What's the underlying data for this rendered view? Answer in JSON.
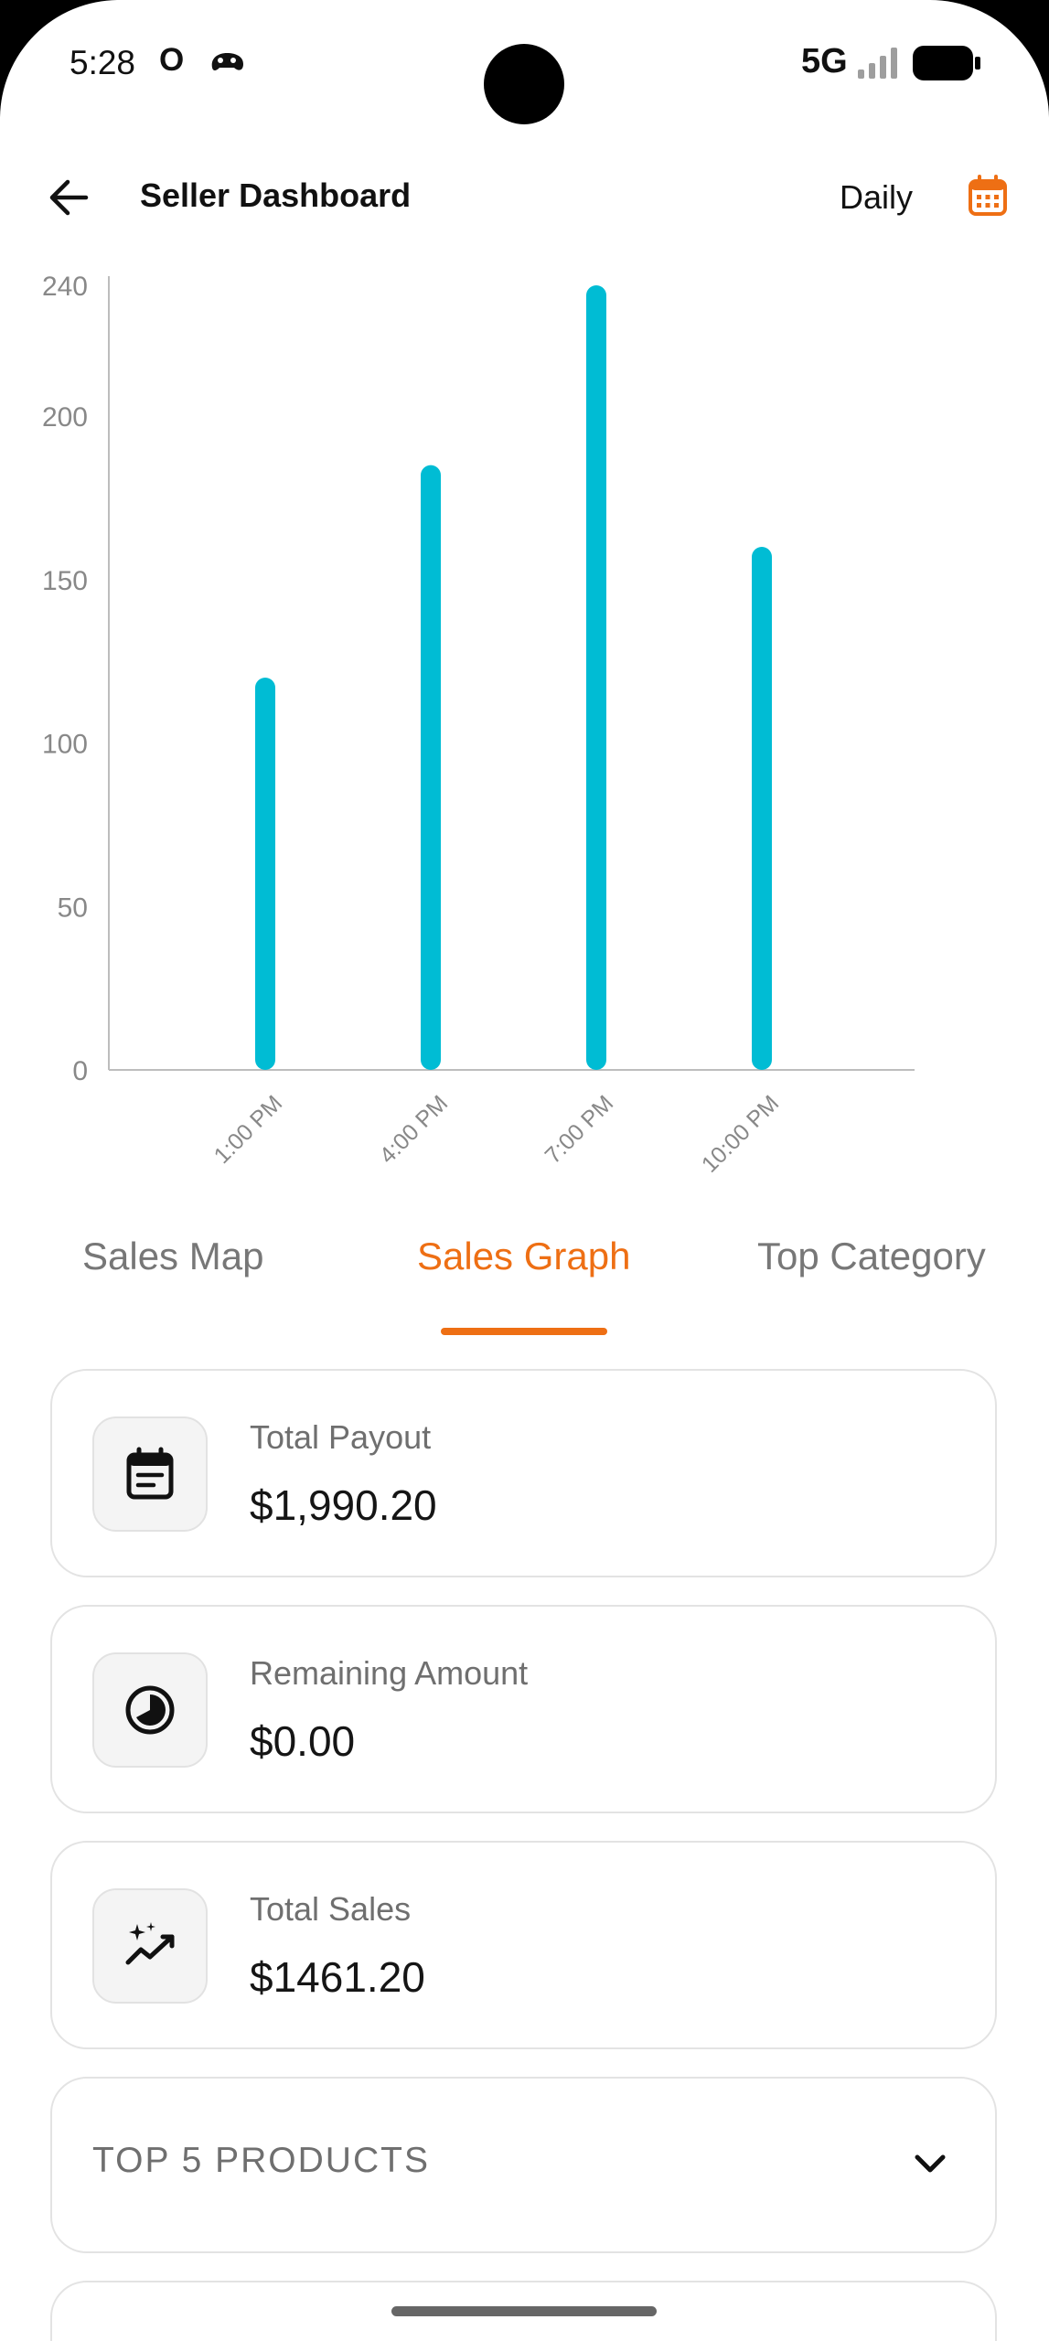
{
  "status_bar": {
    "time": "5:28",
    "notification_letter": "O",
    "app_icon": "game-controller-icon",
    "network": "5G",
    "signal_icon": "cell-signal-icon",
    "battery_icon": "battery-icon"
  },
  "header": {
    "back_icon": "arrow-left-icon",
    "title": "Seller Dashboard",
    "period": "Daily",
    "calendar_icon": "calendar-icon"
  },
  "colors": {
    "accent": "#ee6f14",
    "bar": "#00bcd4",
    "axis": "#bdbdbd",
    "tick_text": "#888888"
  },
  "chart_data": {
    "type": "bar",
    "categories": [
      "1:00 PM",
      "4:00 PM",
      "7:00 PM",
      "10:00 PM"
    ],
    "values": [
      120,
      185,
      240,
      160
    ],
    "y_ticks": [
      0,
      50,
      100,
      150,
      200,
      240
    ],
    "ylim": [
      0,
      240
    ],
    "title": "",
    "xlabel": "",
    "ylabel": "",
    "grid": false
  },
  "tabs": [
    {
      "label": "Sales Map",
      "active": false
    },
    {
      "label": "Sales Graph",
      "active": true
    },
    {
      "label": "Top Category",
      "active": false
    }
  ],
  "summary_cards": [
    {
      "icon": "receipt-calendar-icon",
      "label": "Total Payout",
      "value": "$1,990.20"
    },
    {
      "icon": "pie-chart-icon",
      "label": "Remaining Amount",
      "value": "$0.00"
    },
    {
      "icon": "trending-sparkle-icon",
      "label": "Total Sales",
      "value": "$1461.20"
    }
  ],
  "top_products": {
    "title": "TOP 5 PRODUCTS",
    "chevron_icon": "chevron-down-icon"
  }
}
